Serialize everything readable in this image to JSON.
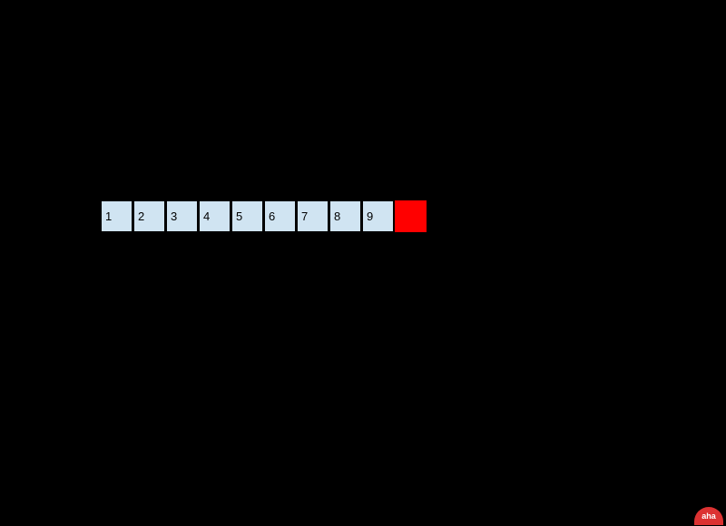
{
  "cells": [
    "1",
    "2",
    "3",
    "4",
    "5",
    "6",
    "7",
    "8",
    "9"
  ],
  "watermark": "aha",
  "colors": {
    "cell_bg": "#d0e4f2",
    "highlight_bg": "#ff0000",
    "page_bg": "#000000"
  }
}
